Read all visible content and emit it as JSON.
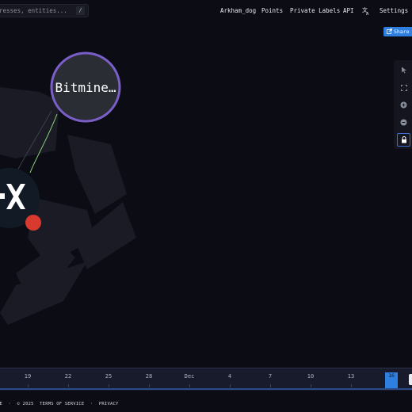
{
  "search": {
    "placeholder": "resses, entities...",
    "shortcut": "/"
  },
  "nav": {
    "items": [
      {
        "label": "Arkham_dog"
      },
      {
        "label": "Points"
      },
      {
        "label": "Private Labels"
      },
      {
        "label": "API"
      },
      {
        "label": "Settings"
      }
    ],
    "translate_icon": "translate-icon"
  },
  "share": {
    "label": "Share",
    "icon": "share-icon"
  },
  "toolbar": {
    "tools": [
      {
        "name": "pointer-icon"
      },
      {
        "name": "fit-view-icon"
      },
      {
        "name": "zoom-in-icon"
      },
      {
        "name": "zoom-out-icon"
      },
      {
        "name": "lock-icon",
        "active": true
      }
    ]
  },
  "graph": {
    "nodes": [
      {
        "label": "Bitmine…",
        "ring_color": "#7b5fc9"
      },
      {
        "label": "OKX",
        "badge_color": "#d83a2e"
      }
    ],
    "edge_color": "#8fd47c"
  },
  "timeline": {
    "ticks": [
      "19",
      "22",
      "25",
      "28",
      "Dec",
      "4",
      "7",
      "10",
      "13",
      "16"
    ],
    "selected": "16"
  },
  "footer": {
    "items": [
      "CE",
      "·",
      "© 2025",
      "TERMS OF SERVICE",
      "·",
      "PRIVACY"
    ]
  }
}
